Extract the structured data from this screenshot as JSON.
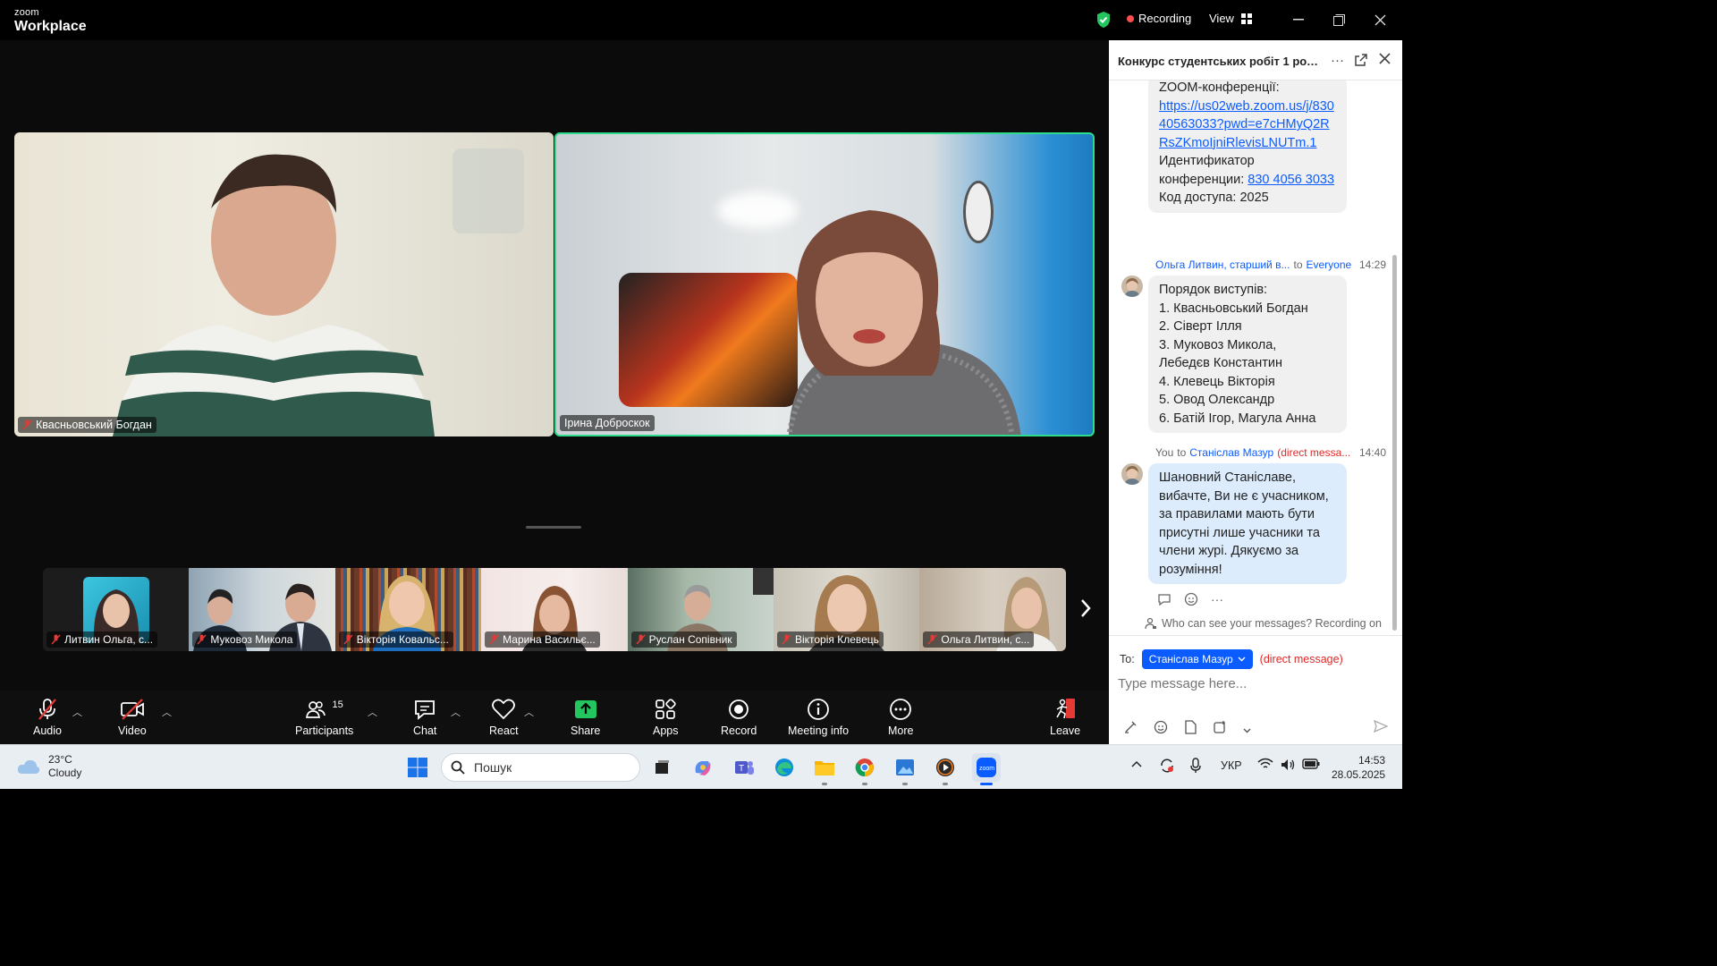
{
  "app": {
    "brand_small": "zoom",
    "brand_big": "Workplace",
    "recording_label": "Recording",
    "view_label": "View"
  },
  "colors": {
    "active_speaker_border": "#2ddc8a",
    "accent": "#0b5cff",
    "recording": "#ff4d4f",
    "direct": "#e02828"
  },
  "main_video": {
    "left": {
      "name": "Квасньовський Богдан",
      "muted": true
    },
    "right": {
      "name": "Ірина Доброскок",
      "muted": false,
      "active_speaker": true
    }
  },
  "gallery": [
    {
      "name": "Литвин Ольга, с...",
      "muted": true
    },
    {
      "name": "Муковоз Микола",
      "muted": true
    },
    {
      "name": "Вікторія Ковальс...",
      "muted": true
    },
    {
      "name": "Марина Васильє...",
      "muted": true
    },
    {
      "name": "Руслан Сопівник",
      "muted": true
    },
    {
      "name": "Вікторія Клевець",
      "muted": true
    },
    {
      "name": "Ольга Литвин, с...",
      "muted": true
    }
  ],
  "toolbar": {
    "audio": "Audio",
    "video": "Video",
    "participants": "Participants",
    "participants_count": "15",
    "chat": "Chat",
    "react": "React",
    "share": "Share",
    "apps": "Apps",
    "record": "Record",
    "meeting_info": "Meeting info",
    "more": "More",
    "leave": "Leave"
  },
  "chat": {
    "title": "Конкурс студентських робіт 1 розд...",
    "msg1": {
      "line1": "ZOOM-конференції:",
      "link": "https://us02web.zoom.us/j/83040563033?pwd=e7cHMyQ2RRsZKmoIjniRlevisLNUTm.1",
      "id_label": "Идентификатор конференции:",
      "id_value": "830 4056 3033",
      "code": "Код доступа: 2025"
    },
    "msg2": {
      "sender": "Ольга Литвин, старший в...",
      "to_word": "to",
      "recipient": "Everyone",
      "time": "14:29",
      "lines": [
        "Порядок виступів:",
        "1. Квасньовський Богдан",
        "2. Сіверт Ілля",
        "3. Муковоз Микола,",
        "Лебедєв Константин",
        "4. Клевець Вікторія",
        "5. Овод Олександр",
        "6. Батій Ігор, Магула Анна"
      ]
    },
    "msg3": {
      "sender": "You",
      "to_word": "to",
      "recipient": "Станіслав Мазур",
      "direct": "(direct messa...",
      "time": "14:40",
      "text": "Шановний Станіславе, вибачте, Ви не є учасником, за правилами мають бути присутні лише учасники та члени журі. Дякуємо за розуміння!"
    },
    "who_can_see": "Who can see your messages? Recording on",
    "to_label": "To:",
    "to_recipient": "Станіслав Мазур",
    "to_direct": "(direct message)",
    "input_placeholder": "Type message here..."
  },
  "taskbar": {
    "temp": "23°C",
    "weather": "Cloudy",
    "search": "Пошук",
    "lang": "УКР",
    "time": "14:53",
    "date": "28.05.2025"
  }
}
